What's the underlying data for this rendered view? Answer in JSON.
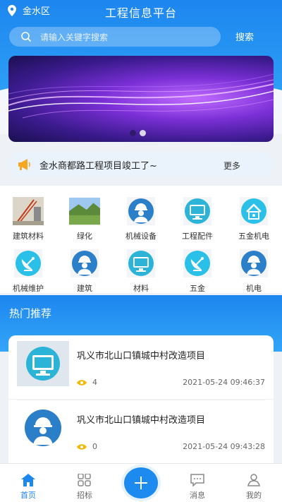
{
  "header": {
    "location": "金水区",
    "title": "工程信息平台"
  },
  "search": {
    "placeholder": "请输入关键字搜索",
    "button": "搜索"
  },
  "notice": {
    "text": "金水商都路工程项目竣工了~",
    "more": "更多"
  },
  "categories": [
    {
      "label": "建筑材料",
      "icon": "crane-photo"
    },
    {
      "label": "绿化",
      "icon": "landscape-photo"
    },
    {
      "label": "机械设备",
      "icon": "worker-icon"
    },
    {
      "label": "工程配件",
      "icon": "monitor-icon"
    },
    {
      "label": "五金机电",
      "icon": "house-icon"
    },
    {
      "label": "机械维护",
      "icon": "satellite-dish-icon"
    },
    {
      "label": "建筑",
      "icon": "worker-icon"
    },
    {
      "label": "材料",
      "icon": "monitor-icon"
    },
    {
      "label": "五金",
      "icon": "satellite-dish-icon"
    },
    {
      "label": "机电",
      "icon": "worker-icon"
    }
  ],
  "hot": {
    "title": "热门推荐",
    "items": [
      {
        "title": "巩义市北山口镇城中村改造项目",
        "views": "4",
        "time": "2021-05-24 09:46:37",
        "icon": "monitor-icon"
      },
      {
        "title": "巩义市北山口镇城中村改造项目",
        "views": "0",
        "time": "2021-05-24 09:43:28",
        "icon": "worker-icon"
      }
    ]
  },
  "nav": {
    "home": "首页",
    "bid": "招标",
    "message": "消息",
    "mine": "我的"
  },
  "colors": {
    "primary": "#1d86ef",
    "icon_bg": "#2a7fc8",
    "cyan": "#2bc0e8"
  }
}
